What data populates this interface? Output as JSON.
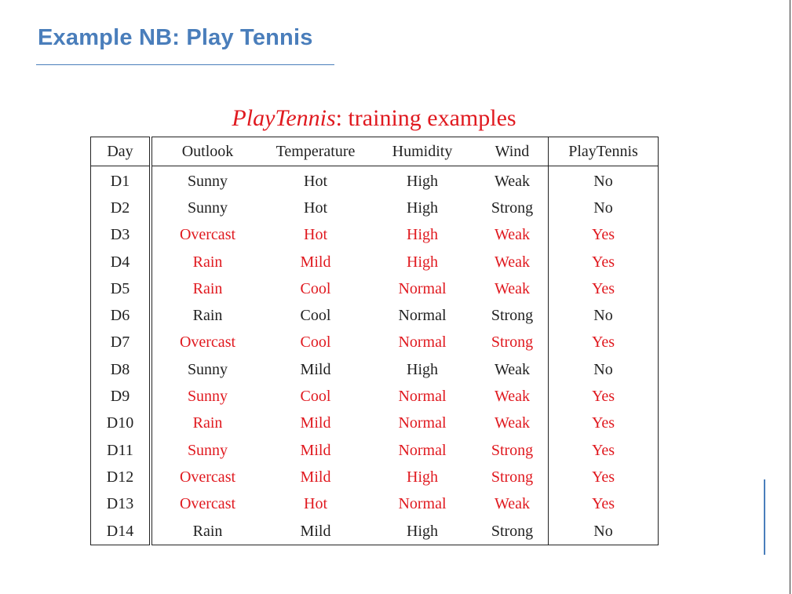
{
  "slide": {
    "title": "Example NB: Play Tennis"
  },
  "table": {
    "caption_italic": "PlayTennis",
    "caption_rest": ": training examples",
    "headers": [
      "Day",
      "Outlook",
      "Temperature",
      "Humidity",
      "Wind",
      "PlayTennis"
    ],
    "rows": [
      {
        "day": "D1",
        "outlook": "Sunny",
        "temperature": "Hot",
        "humidity": "High",
        "wind": "Weak",
        "play": "No",
        "highlighted": false
      },
      {
        "day": "D2",
        "outlook": "Sunny",
        "temperature": "Hot",
        "humidity": "High",
        "wind": "Strong",
        "play": "No",
        "highlighted": false
      },
      {
        "day": "D3",
        "outlook": "Overcast",
        "temperature": "Hot",
        "humidity": "High",
        "wind": "Weak",
        "play": "Yes",
        "highlighted": true
      },
      {
        "day": "D4",
        "outlook": "Rain",
        "temperature": "Mild",
        "humidity": "High",
        "wind": "Weak",
        "play": "Yes",
        "highlighted": true
      },
      {
        "day": "D5",
        "outlook": "Rain",
        "temperature": "Cool",
        "humidity": "Normal",
        "wind": "Weak",
        "play": "Yes",
        "highlighted": true
      },
      {
        "day": "D6",
        "outlook": "Rain",
        "temperature": "Cool",
        "humidity": "Normal",
        "wind": "Strong",
        "play": "No",
        "highlighted": false
      },
      {
        "day": "D7",
        "outlook": "Overcast",
        "temperature": "Cool",
        "humidity": "Normal",
        "wind": "Strong",
        "play": "Yes",
        "highlighted": true
      },
      {
        "day": "D8",
        "outlook": "Sunny",
        "temperature": "Mild",
        "humidity": "High",
        "wind": "Weak",
        "play": "No",
        "highlighted": false
      },
      {
        "day": "D9",
        "outlook": "Sunny",
        "temperature": "Cool",
        "humidity": "Normal",
        "wind": "Weak",
        "play": "Yes",
        "highlighted": true
      },
      {
        "day": "D10",
        "outlook": "Rain",
        "temperature": "Mild",
        "humidity": "Normal",
        "wind": "Weak",
        "play": "Yes",
        "highlighted": true
      },
      {
        "day": "D11",
        "outlook": "Sunny",
        "temperature": "Mild",
        "humidity": "Normal",
        "wind": "Strong",
        "play": "Yes",
        "highlighted": true
      },
      {
        "day": "D12",
        "outlook": "Overcast",
        "temperature": "Mild",
        "humidity": "High",
        "wind": "Strong",
        "play": "Yes",
        "highlighted": true
      },
      {
        "day": "D13",
        "outlook": "Overcast",
        "temperature": "Hot",
        "humidity": "Normal",
        "wind": "Weak",
        "play": "Yes",
        "highlighted": true
      },
      {
        "day": "D14",
        "outlook": "Rain",
        "temperature": "Mild",
        "humidity": "High",
        "wind": "Strong",
        "play": "No",
        "highlighted": false
      }
    ]
  },
  "colors": {
    "title_blue": "#4a7ebb",
    "positive_red": "#e0191f",
    "text_dark": "#222222"
  }
}
